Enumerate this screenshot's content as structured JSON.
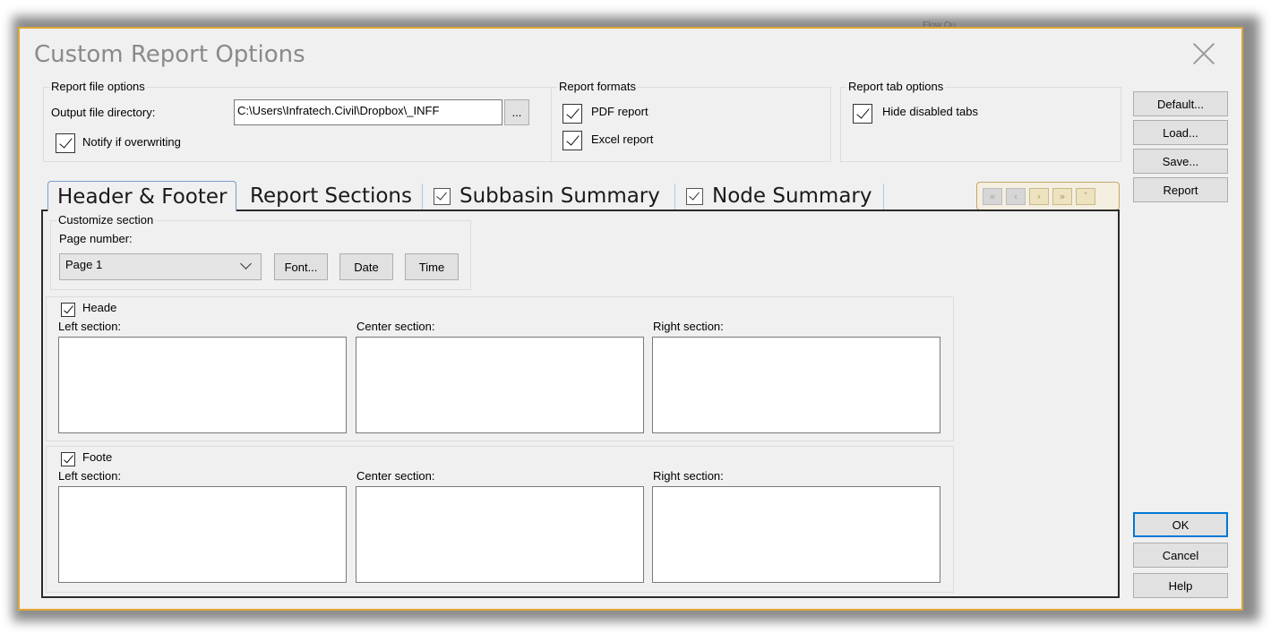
{
  "dialog": {
    "title": "Custom Report Options",
    "background_text": "Flow Ou"
  },
  "report_file_options": {
    "group_label": "Report file options",
    "output_dir_label": "Output file directory:",
    "output_dir_value": "C:\\Users\\Infratech.Civil\\Dropbox\\_INFF",
    "browse_label": "...",
    "notify_label": "Notify if overwriting",
    "notify_checked": true
  },
  "report_formats": {
    "group_label": "Report formats",
    "pdf_label": "PDF report",
    "excel_label": "Excel report"
  },
  "report_tab_options": {
    "group_label": "Report tab options",
    "hide_disabled_label": "Hide disabled tabs"
  },
  "side_buttons": {
    "default": "Default...",
    "load": "Load...",
    "save": "Save...",
    "report": "Report",
    "ok": "OK",
    "cancel": "Cancel",
    "help": "Help"
  },
  "tabs": [
    {
      "label": "Header & Footer",
      "active": true,
      "checkbox": false
    },
    {
      "label": "Report Sections",
      "active": false,
      "checkbox": false
    },
    {
      "label": "Subbasin Summary",
      "active": false,
      "checkbox": true
    },
    {
      "label": "Node Summary",
      "active": false,
      "checkbox": true
    }
  ],
  "nav_icons": [
    "first-icon",
    "prev-icon",
    "next-icon",
    "last-icon",
    "menu-down-icon"
  ],
  "customize_section": {
    "group_label": "Customize section",
    "page_number_label": "Page number:",
    "page_number_value": "Page 1",
    "font_button": "Font...",
    "date_button": "Date",
    "time_button": "Time"
  },
  "header": {
    "label": "Heade",
    "checked": true,
    "left_label": "Left section:",
    "center_label": "Center section:",
    "right_label": "Right section:"
  },
  "footer": {
    "label": "Foote",
    "checked": true,
    "left_label": "Left section:",
    "center_label": "Center section:",
    "right_label": "Right section:"
  },
  "colors": {
    "dialog_border": "#e0a634",
    "default_button_border": "#0078d7",
    "title_text": "#8a8a8a"
  }
}
